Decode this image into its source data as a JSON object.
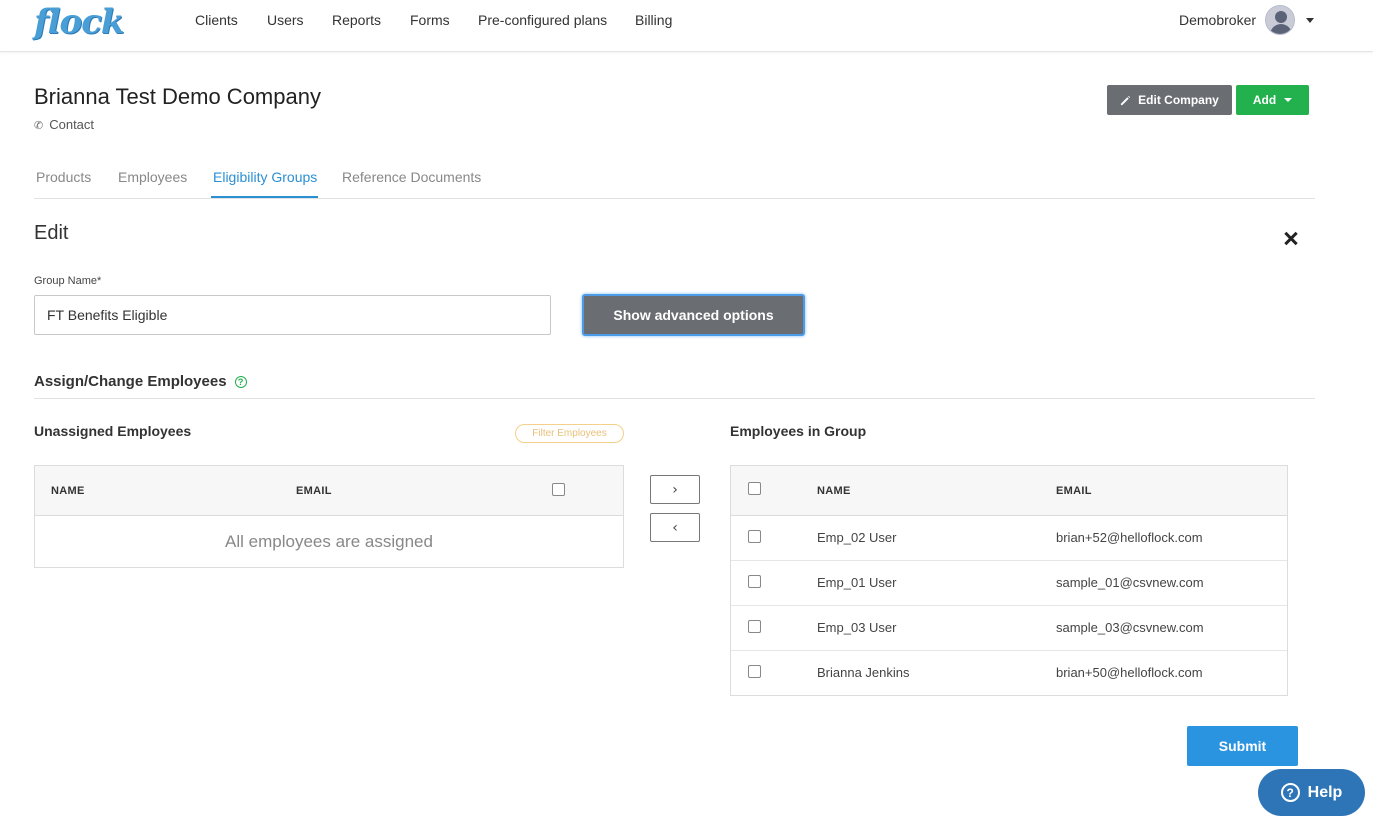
{
  "brand": {
    "logo_text": "flock",
    "accent_color": "#4a9ed6"
  },
  "nav": {
    "items": [
      {
        "label": "Clients"
      },
      {
        "label": "Users"
      },
      {
        "label": "Reports"
      },
      {
        "label": "Forms"
      },
      {
        "label": "Pre-configured plans"
      },
      {
        "label": "Billing"
      }
    ],
    "user_name": "Demobroker"
  },
  "header": {
    "company_name": "Brianna Test Demo Company",
    "contact_label": "Contact",
    "edit_company_label": "Edit Company",
    "add_label": "Add"
  },
  "tabs": [
    {
      "label": "Products",
      "active": false
    },
    {
      "label": "Employees",
      "active": false
    },
    {
      "label": "Eligibility Groups",
      "active": true
    },
    {
      "label": "Reference Documents",
      "active": false
    }
  ],
  "edit": {
    "title": "Edit",
    "group_name_label": "Group Name*",
    "group_name_value": "FT Benefits Eligible",
    "advanced_button": "Show advanced options"
  },
  "assign": {
    "title": "Assign/Change Employees",
    "help_glyph": "?",
    "unassigned_title": "Unassigned Employees",
    "filter_label": "Filter Employees",
    "group_title": "Employees in Group",
    "columns": {
      "name": "NAME",
      "email": "EMAIL"
    },
    "empty_message": "All employees are assigned",
    "move_right_glyph": "›",
    "move_left_glyph": "‹",
    "group_employees": [
      {
        "name": "Emp_02 User",
        "email": "brian+52@helloflock.com"
      },
      {
        "name": "Emp_01 User",
        "email": "sample_01@csvnew.com"
      },
      {
        "name": "Emp_03 User",
        "email": "sample_03@csvnew.com"
      },
      {
        "name": "Brianna Jenkins",
        "email": "brian+50@helloflock.com"
      }
    ]
  },
  "actions": {
    "submit_label": "Submit"
  },
  "help_widget": {
    "label": "Help",
    "glyph": "?"
  },
  "colors": {
    "primary": "#2b94e0",
    "success": "#22b14c",
    "gray_button": "#6a6e73",
    "help": "#2e75b8"
  }
}
